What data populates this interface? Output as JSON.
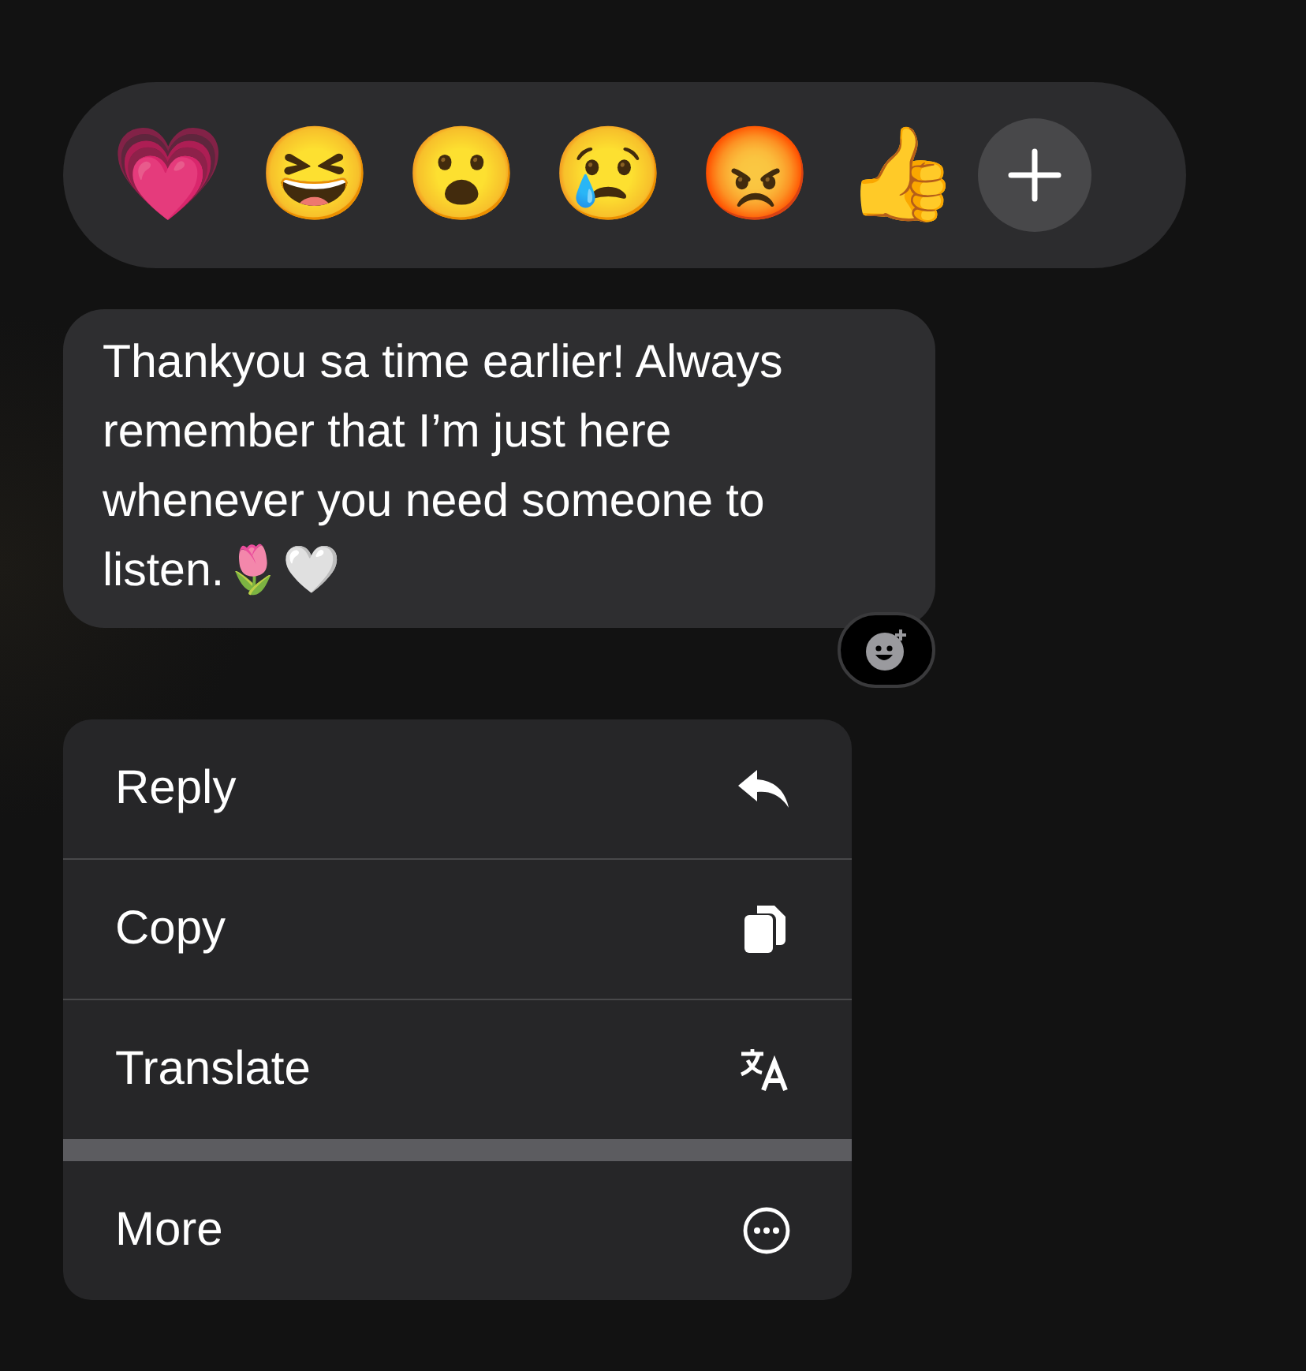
{
  "reactions": [
    {
      "emoji": "💗"
    },
    {
      "emoji": "😆"
    },
    {
      "emoji": "😮"
    },
    {
      "emoji": "😢"
    },
    {
      "emoji": "😡"
    },
    {
      "emoji": "👍"
    }
  ],
  "message": {
    "text": "Thankyou sa time earlier! Always remember that I’m just here whenever you need someone to listen.🌷🤍"
  },
  "menu": [
    {
      "label": "Reply",
      "kind": "reply"
    },
    {
      "label": "Copy",
      "kind": "copy"
    },
    {
      "label": "Translate",
      "kind": "translate"
    },
    {
      "label": "More",
      "kind": "more"
    }
  ]
}
